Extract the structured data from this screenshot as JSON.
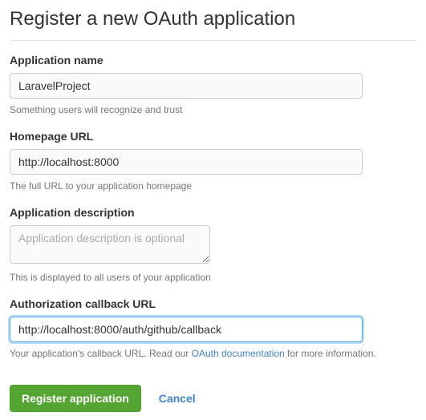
{
  "page": {
    "title": "Register a new OAuth application"
  },
  "fields": {
    "app_name": {
      "label": "Application name",
      "value": "LaravelProject",
      "helper": "Something users will recognize and trust"
    },
    "homepage": {
      "label": "Homepage URL",
      "value": "http://localhost:8000",
      "helper": "The full URL to your application homepage"
    },
    "description": {
      "label": "Application description",
      "value": "",
      "placeholder": "Application description is optional",
      "helper": "This is displayed to all users of your application"
    },
    "callback": {
      "label": "Authorization callback URL",
      "value": "http://localhost:8000/auth/github/callback",
      "helper_prefix": "Your application's callback URL. Read our ",
      "helper_link": "OAuth documentation",
      "helper_suffix": " for more information."
    }
  },
  "actions": {
    "register": "Register application",
    "cancel": "Cancel"
  }
}
